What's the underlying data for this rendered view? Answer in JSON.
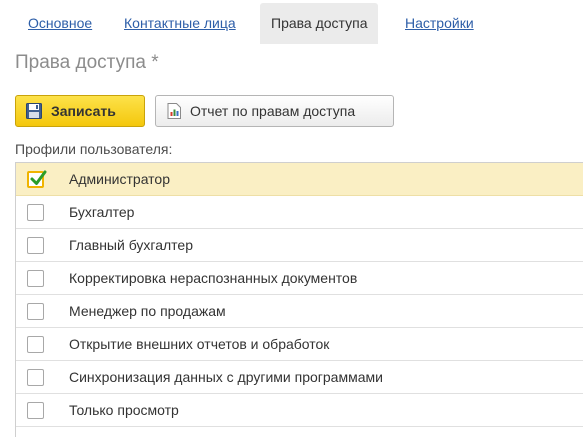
{
  "tabs": [
    {
      "label": "Основное",
      "active": false
    },
    {
      "label": "Контактные лица",
      "active": false
    },
    {
      "label": "Права доступа",
      "active": true
    },
    {
      "label": "Настройки",
      "active": false
    }
  ],
  "page_title": "Права доступа *",
  "toolbar": {
    "save_label": "Записать",
    "report_label": "Отчет по правам доступа",
    "save_icon": "floppy-disk-icon",
    "report_icon": "report-chart-icon"
  },
  "profiles_label": "Профили пользователя:",
  "profiles": [
    {
      "label": "Администратор",
      "checked": true
    },
    {
      "label": "Бухгалтер",
      "checked": false
    },
    {
      "label": "Главный бухгалтер",
      "checked": false
    },
    {
      "label": "Корректировка нераспознанных документов",
      "checked": false
    },
    {
      "label": "Менеджер по продажам",
      "checked": false
    },
    {
      "label": "Открытие внешних отчетов и обработок",
      "checked": false
    },
    {
      "label": "Синхронизация данных с другими программами",
      "checked": false
    },
    {
      "label": "Только просмотр",
      "checked": false
    }
  ],
  "colors": {
    "link": "#2d5ea8",
    "save_button": "#f4c70c",
    "selected_row": "#faefc4",
    "check": "#2a9d2a"
  }
}
